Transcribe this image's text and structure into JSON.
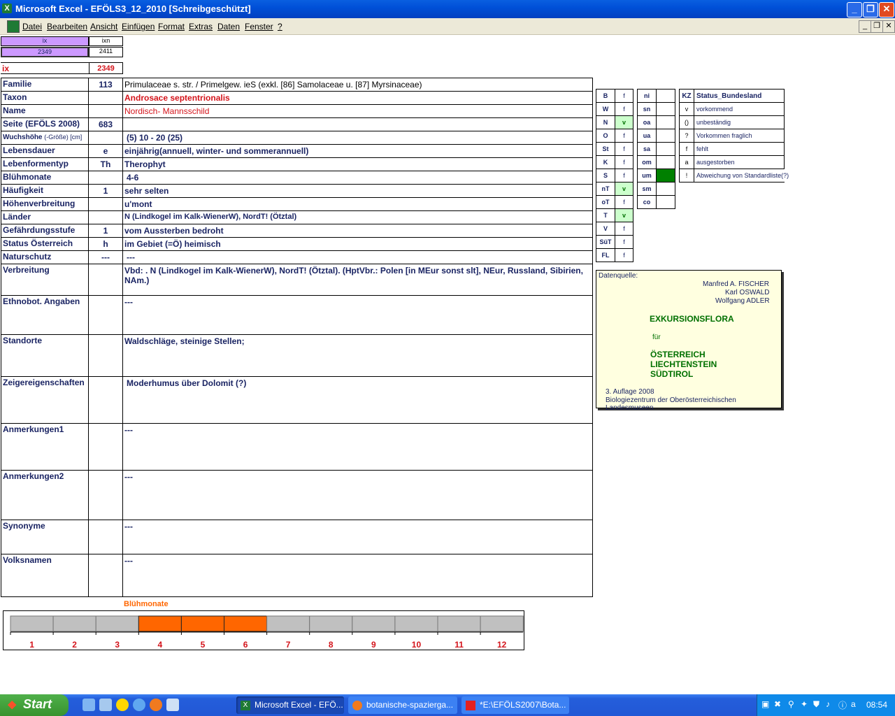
{
  "window": {
    "title": "Microsoft Excel - EFÖLS3_12_2010  [Schreibgeschützt]",
    "app_icon": "X"
  },
  "menu": [
    {
      "label": "Datei"
    },
    {
      "label": "Bearbeiten"
    },
    {
      "label": "Ansicht"
    },
    {
      "label": "Einfügen"
    },
    {
      "label": "Format"
    },
    {
      "label": "Extras"
    },
    {
      "label": "Daten"
    },
    {
      "label": "Fenster"
    },
    {
      "label": "?"
    }
  ],
  "index": {
    "ix_header": "ix",
    "ixn_header": "ixn",
    "ix_value": "2349",
    "ixn_value": "2411",
    "ix_label": "ix",
    "ix_current": "2349"
  },
  "rows": [
    {
      "label": "Familie",
      "code": "113",
      "value": "Primulaceae s. str.  /  Primelgew. ieS (exkl. [86] Samolaceae u. [87] Myrsinaceae)"
    },
    {
      "label": "Taxon",
      "code": "",
      "value": "Androsace septentrionalis"
    },
    {
      "label": "Name",
      "code": "",
      "value": "Nordisch- Mannsschild"
    },
    {
      "label": "Seite (EFÖLS 2008)",
      "code": "683",
      "value": ""
    },
    {
      "label": "Wuchshöhe",
      "label_extra": "(-Größe) [cm]",
      "code": "",
      "value": "(5) 10 - 20 (25)"
    },
    {
      "label": "Lebensdauer",
      "code": "e",
      "value": "einjährig(annuell, winter- und sommerannuell)"
    },
    {
      "label": "Lebenformentyp",
      "code": "Th",
      "value": "Therophyt"
    },
    {
      "label": "Blühmonate",
      "code": "",
      "value": "4-6"
    },
    {
      "label": "Häufigkeit",
      "code": "1",
      "value": "sehr selten"
    },
    {
      "label": "Höhenverbreitung",
      "code": "",
      "value": "u'mont"
    },
    {
      "label": "Länder",
      "code": "",
      "value": "N (Lindkogel im Kalk-WienerW), NordT! (Ötztal)"
    },
    {
      "label": "Gefährdungsstufe",
      "code": "1",
      "value": "vom Aussterben bedroht"
    },
    {
      "label": "Status Österreich",
      "code": "h",
      "value": "im Gebiet (=Ö) heimisch"
    },
    {
      "label": "Naturschutz",
      "code": "---",
      "value": "---"
    }
  ],
  "big_rows": [
    {
      "label": "Verbreitung",
      "value": "Vbd: . N (Lindkogel im Kalk-WienerW), NordT! (Ötztal). (HptVbr.: Polen [in MEur sonst slt], NEur, Russland, Sibirien,",
      "value2": "NAm.)"
    },
    {
      "label": "Ethnobot. Angaben",
      "value": "---"
    },
    {
      "label": "Standorte",
      "value": "Waldschläge, steinige Stellen;"
    },
    {
      "label": "Zeigereigenschaften",
      "value": "Moderhumus über Dolomit (?)"
    },
    {
      "label": "Anmerkungen1",
      "value": "---"
    },
    {
      "label": "Anmerkungen2",
      "value": "---"
    },
    {
      "label": "Synonyme",
      "value": "---"
    },
    {
      "label": "Volksnamen",
      "value": "---"
    }
  ],
  "states": [
    {
      "code": "B",
      "status": "f",
      "present": false
    },
    {
      "code": "W",
      "status": "f",
      "present": false
    },
    {
      "code": "N",
      "status": "v",
      "present": true
    },
    {
      "code": "O",
      "status": "f",
      "present": false
    },
    {
      "code": "St",
      "status": "f",
      "present": false
    },
    {
      "code": "K",
      "status": "f",
      "present": false
    },
    {
      "code": "S",
      "status": "f",
      "present": false
    },
    {
      "code": "nT",
      "status": "v",
      "present": true
    },
    {
      "code": "oT",
      "status": "f",
      "present": false
    },
    {
      "code": "T",
      "status": "v",
      "present": true
    },
    {
      "code": "V",
      "status": "f",
      "present": false
    },
    {
      "code": "SüT",
      "status": "f",
      "present": false
    },
    {
      "code": "FL",
      "status": "f",
      "present": false
    }
  ],
  "regions": [
    {
      "code": "ni",
      "status": ""
    },
    {
      "code": "sn",
      "status": ""
    },
    {
      "code": "oa",
      "status": ""
    },
    {
      "code": "ua",
      "status": ""
    },
    {
      "code": "sa",
      "status": ""
    },
    {
      "code": "om",
      "status": ""
    },
    {
      "code": "um",
      "status": "",
      "highlight": true
    },
    {
      "code": "sm",
      "status": ""
    },
    {
      "code": "co",
      "status": ""
    }
  ],
  "legend": {
    "kz_header": "KZ",
    "title": "Status_Bundesland",
    "items": [
      {
        "code": "v",
        "label": "vorkommend"
      },
      {
        "code": "()",
        "label": "unbeständig"
      },
      {
        "code": "?",
        "label": "Vorkommen fraglich"
      },
      {
        "code": "f",
        "label": "fehlt"
      },
      {
        "code": "a",
        "label": "ausgestorben"
      },
      {
        "code": "!",
        "label": "Abweichung von Standardliste(?)"
      }
    ]
  },
  "source": {
    "heading": "Datenquelle:",
    "author1": "Manfred A. FISCHER",
    "author2": "Karl OSWALD",
    "author3": "Wolfgang ADLER",
    "book": "EXKURSIONSFLORA",
    "fuer": "für",
    "country1": "ÖSTERREICH",
    "country2": "LIECHTENSTEIN",
    "country3": "SÜDTIROL",
    "edition": "3. Auflage 2008",
    "publisher": "Biologiezentrum der Oberösterreichischen Landesmuseen"
  },
  "bloom_chart": {
    "title": "Blühmonate",
    "months": [
      "1",
      "2",
      "3",
      "4",
      "5",
      "6",
      "7",
      "8",
      "9",
      "10",
      "11",
      "12"
    ],
    "active": [
      4,
      5,
      6
    ],
    "active_color": "#ff6600",
    "inactive_color": "#c0c0c0"
  },
  "taskbar": {
    "start_label": "Start",
    "tasks": [
      {
        "label": "Microsoft Excel - EFÖ..."
      },
      {
        "label": "botanische-spazierga..."
      },
      {
        "label": "*E:\\EFÖLS2007\\Bota..."
      }
    ],
    "clock": "08:54"
  },
  "colors": {
    "index_purple": "#cc99ff",
    "present_green": "#ccffcc",
    "highlight_green": "#008000",
    "label_navy": "#1a2463",
    "accent_red": "#d4141b",
    "info_yellow": "#ffffe0"
  }
}
